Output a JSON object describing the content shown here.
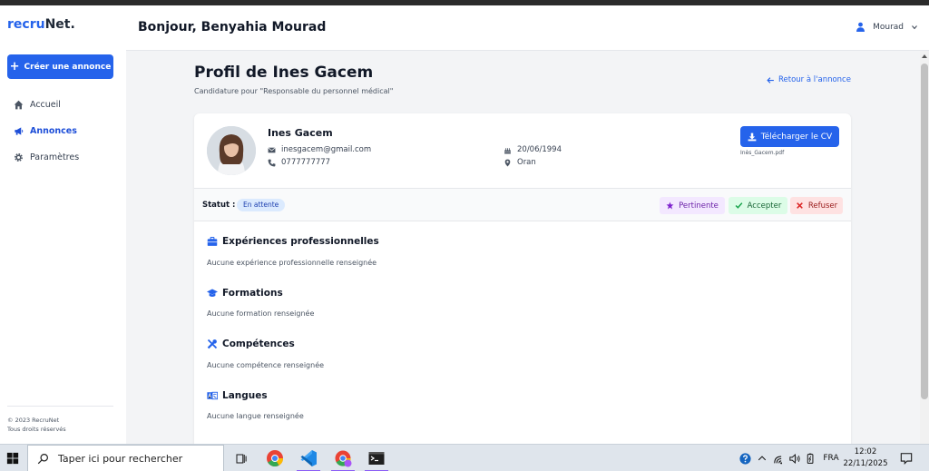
{
  "app": {
    "logo_prefix": "recru",
    "logo_suffix": "Net.",
    "brand_color": "#2563eb"
  },
  "sidebar": {
    "create_button": "Créer une annonce",
    "items": [
      {
        "label": "Accueil",
        "icon": "home-icon",
        "active": false
      },
      {
        "label": "Annonces",
        "icon": "megaphone-icon",
        "active": true
      },
      {
        "label": "Paramètres",
        "icon": "gear-icon",
        "active": false
      }
    ],
    "footer_line1": "© 2023 RecruNet",
    "footer_line2": "Tous droits réservés"
  },
  "header": {
    "greeting": "Bonjour, Benyahia Mourad",
    "user_name": "Mourad"
  },
  "page": {
    "title": "Profil de Ines Gacem",
    "subtitle": "Candidature pour \"Responsable du personnel médical\"",
    "back_link": "Retour à l'annonce"
  },
  "candidate": {
    "name": "Ines Gacem",
    "email": "inesgacem@gmail.com",
    "phone": "0777777777",
    "birth_date": "20/06/1994",
    "city": "Oran",
    "download_button": "Télécharger le CV",
    "cv_file": "Inès_Gacem.pdf"
  },
  "status": {
    "label": "Statut :",
    "value": "En attente",
    "actions": {
      "pertinent": "Pertinente",
      "accept": "Accepter",
      "reject": "Refuser"
    }
  },
  "sections": [
    {
      "title": "Expériences professionnelles",
      "icon": "briefcase-icon",
      "empty_text": "Aucune expérience professionnelle renseignée"
    },
    {
      "title": "Formations",
      "icon": "graduation-cap-icon",
      "empty_text": "Aucune formation renseignée"
    },
    {
      "title": "Compétences",
      "icon": "tools-icon",
      "empty_text": "Aucune compétence renseignée"
    },
    {
      "title": "Langues",
      "icon": "language-icon",
      "empty_text": "Aucune langue renseignée"
    }
  ],
  "taskbar": {
    "search_placeholder": "Taper ici pour rechercher",
    "language": "FRA",
    "time": "12:02",
    "date": "22/11/2025"
  }
}
